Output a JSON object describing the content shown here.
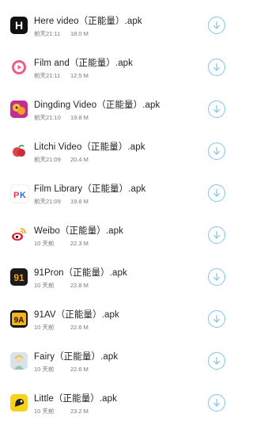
{
  "downloads": [
    {
      "name": "Here video（正能量）.apk",
      "time": "前天21:11",
      "size": "18.0 M",
      "icon": "here-video-h-icon"
    },
    {
      "name": "Film and（正能量）.apk",
      "time": "前天21:11",
      "size": "12.5 M",
      "icon": "film-and-play-icon"
    },
    {
      "name": "Dingding Video（正能量）.apk",
      "time": "前天21:10",
      "size": "19.8 M",
      "icon": "dingding-video-icon"
    },
    {
      "name": "Litchi Video（正能量）.apk",
      "time": "前天21:09",
      "size": "20.4 M",
      "icon": "litchi-video-icon"
    },
    {
      "name": "Film Library（正能量）.apk",
      "time": "前天21:09",
      "size": "19.8 M",
      "icon": "film-library-pk-icon"
    },
    {
      "name": "Weibo（正能量）.apk",
      "time": "10 天前",
      "size": "22.3 M",
      "icon": "weibo-icon"
    },
    {
      "name": "91Pron（正能量）.apk",
      "time": "10 天前",
      "size": "22.8 M",
      "icon": "91pron-icon"
    },
    {
      "name": "91AV（正能量）.apk",
      "time": "10 天前",
      "size": "22.6 M",
      "icon": "91av-icon"
    },
    {
      "name": "Fairy（正能量）.apk",
      "time": "10 天前",
      "size": "22.6 M",
      "icon": "fairy-icon"
    },
    {
      "name": "Little（正能量）.apk",
      "time": "10 天前",
      "size": "23.2 M",
      "icon": "little-icon"
    }
  ],
  "colors": {
    "download_accent": "#7ec3f0",
    "title_text": "#222222",
    "meta_text": "#777777"
  }
}
